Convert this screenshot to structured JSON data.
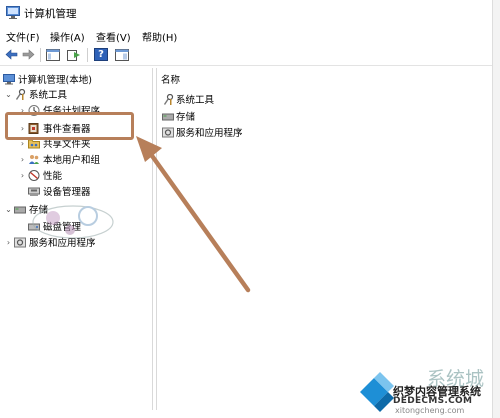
{
  "window": {
    "title": "计算机管理"
  },
  "menu": {
    "items": [
      {
        "label": "文件(F)"
      },
      {
        "label": "操作(A)"
      },
      {
        "label": "查看(V)"
      },
      {
        "label": "帮助(H)"
      }
    ]
  },
  "toolbar": {
    "back_icon": "back-arrow-icon",
    "forward_icon": "forward-arrow-icon",
    "help_glyph": "?"
  },
  "tree": {
    "root": "计算机管理(本地)",
    "system_tools": "系统工具",
    "task_scheduler": "任务计划程序",
    "event_viewer": "事件查看器",
    "shared_folders": "共享文件夹",
    "local_users": "本地用户和组",
    "performance": "性能",
    "device_manager": "设备管理器",
    "storage": "存储",
    "disk_management": "磁盘管理",
    "services_apps": "服务和应用程序"
  },
  "list": {
    "header": "名称",
    "rows": [
      {
        "label": "系统工具"
      },
      {
        "label": "存储"
      },
      {
        "label": "服务和应用程序"
      }
    ]
  },
  "watermark": {
    "main": "织梦内容管理系统",
    "url": "DEDECMS.COM",
    "big": "系统城",
    "sub": "xitongcheng.com"
  },
  "colors": {
    "highlight": "#b77f5a",
    "arrow": "#b77f5a",
    "selection": "#cce4f7"
  }
}
